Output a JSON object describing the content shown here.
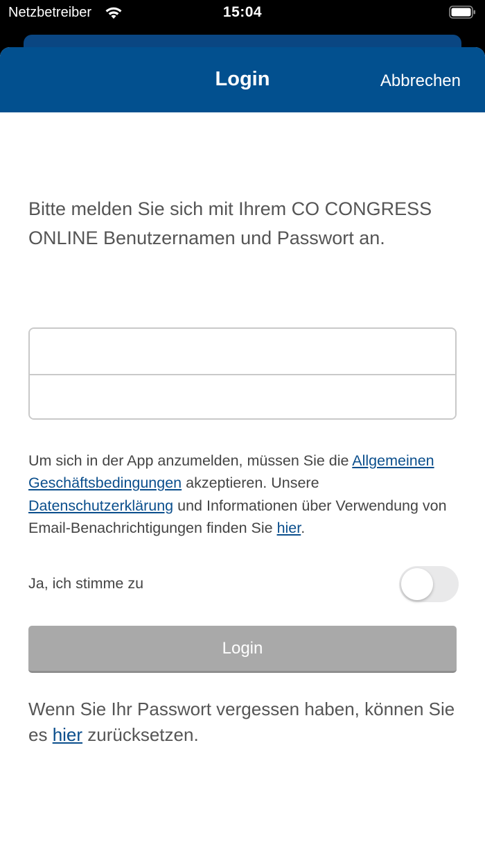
{
  "status_bar": {
    "carrier": "Netzbetreiber",
    "time": "15:04"
  },
  "nav": {
    "title": "Login",
    "cancel_label": "Abbrechen"
  },
  "intro_text": "Bitte melden Sie sich mit Ihrem CO CONGRESS ONLINE Benutzernamen und Passwort an.",
  "form": {
    "username_value": "",
    "password_value": ""
  },
  "terms": {
    "part1": "Um sich in der App anzumelden, müssen Sie die ",
    "agb_link": "Allgemeinen Geschäftsbedingungen",
    "part2": " akzeptieren. Unsere ",
    "privacy_link": "Datenschutzerklärung",
    "part3": " und Informationen über Verwendung von Email-Benachrichtigungen finden Sie ",
    "here_link": "hier",
    "part4": "."
  },
  "agree": {
    "label": "Ja, ich stimme zu",
    "checked": false
  },
  "login_button_label": "Login",
  "forgot": {
    "part1": "Wenn Sie Ihr Passwort vergessen haben, können Sie es ",
    "link": "hier",
    "part2": " zurücksetzen."
  },
  "colors": {
    "brand_blue": "#02508f",
    "link_blue": "#0a4e8c",
    "button_disabled": "#a9a9a9"
  },
  "icons": [
    "wifi-icon",
    "battery-icon"
  ]
}
